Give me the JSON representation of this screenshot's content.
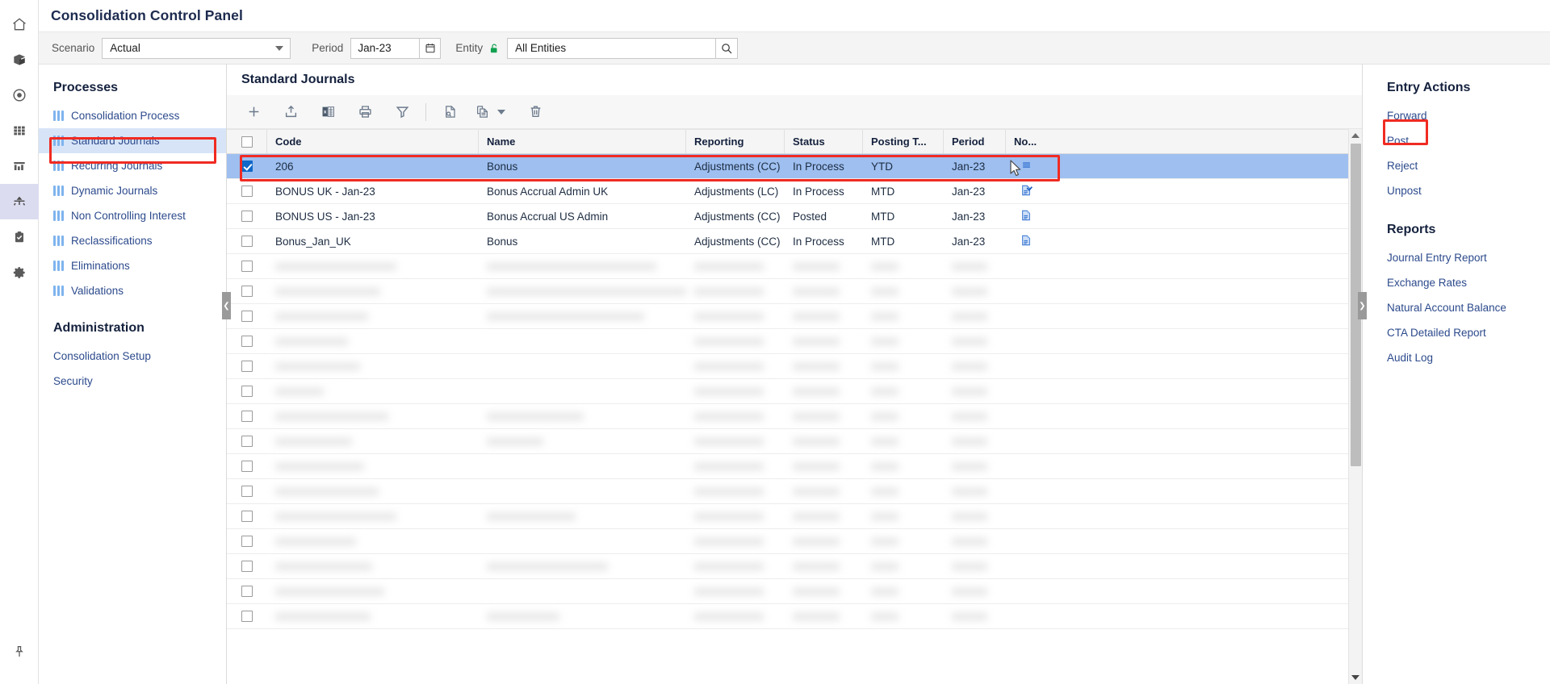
{
  "window": {
    "title": "Consolidation Control Panel"
  },
  "rail": {
    "items": [
      {
        "name": "home-icon",
        "label": "Home"
      },
      {
        "name": "cube-icon",
        "label": "Cube"
      },
      {
        "name": "target-icon",
        "label": "Target"
      },
      {
        "name": "grid-icon",
        "label": "Grid"
      },
      {
        "name": "report-icon",
        "label": "Reports"
      },
      {
        "name": "consolidation-icon",
        "label": "Consolidation"
      },
      {
        "name": "clipboard-check-icon",
        "label": "Tasks"
      },
      {
        "name": "gear-icon",
        "label": "Settings"
      }
    ],
    "pin": {
      "name": "pin-icon",
      "label": "Pin"
    }
  },
  "filterbar": {
    "scenario_label": "Scenario",
    "scenario_value": "Actual",
    "period_label": "Period",
    "period_value": "Jan-23",
    "entity_label": "Entity",
    "entity_value": "All Entities"
  },
  "sidebar": {
    "processes_heading": "Processes",
    "processes": [
      {
        "label": "Consolidation Process",
        "selected": false
      },
      {
        "label": "Standard Journals",
        "selected": true
      },
      {
        "label": "Recurring Journals",
        "selected": false
      },
      {
        "label": "Dynamic Journals",
        "selected": false
      },
      {
        "label": "Non Controlling Interest",
        "selected": false
      },
      {
        "label": "Reclassifications",
        "selected": false
      },
      {
        "label": "Eliminations",
        "selected": false
      },
      {
        "label": "Validations",
        "selected": false
      }
    ],
    "administration_heading": "Administration",
    "administration": [
      {
        "label": "Consolidation Setup"
      },
      {
        "label": "Security"
      }
    ]
  },
  "content": {
    "title": "Standard Journals",
    "toolbar": [
      {
        "name": "add-button",
        "label": "Add"
      },
      {
        "name": "upload-button",
        "label": "Upload"
      },
      {
        "name": "export-excel-button",
        "label": "Export to Excel"
      },
      {
        "name": "print-button",
        "label": "Print"
      },
      {
        "name": "filter-button",
        "label": "Filter"
      },
      {
        "name": "inspect-button",
        "label": "Inspect"
      },
      {
        "name": "copy-button",
        "label": "Copy"
      },
      {
        "name": "delete-button",
        "label": "Delete"
      }
    ]
  },
  "table": {
    "columns": [
      "",
      "Code",
      "Name",
      "Reporting",
      "Status",
      "Posting T...",
      "Period",
      "No..."
    ],
    "rows": [
      {
        "checked": true,
        "selected": true,
        "code": "206",
        "name": "Bonus",
        "reporting": "Adjustments (CC)",
        "status": "In Process",
        "posting_type": "YTD",
        "period": "Jan-23",
        "note_icon": "note-lines-icon"
      },
      {
        "checked": false,
        "selected": false,
        "code": "BONUS UK - Jan-23",
        "name": "Bonus Accrual Admin UK",
        "reporting": "Adjustments (LC)",
        "status": "In Process",
        "posting_type": "MTD",
        "period": "Jan-23",
        "note_icon": "note-check-icon"
      },
      {
        "checked": false,
        "selected": false,
        "code": "BONUS US - Jan-23",
        "name": "Bonus Accrual US Admin",
        "reporting": "Adjustments (CC)",
        "status": "Posted",
        "posting_type": "MTD",
        "period": "Jan-23",
        "note_icon": "note-doc-icon"
      },
      {
        "checked": false,
        "selected": false,
        "code": "Bonus_Jan_UK",
        "name": "Bonus",
        "reporting": "Adjustments (CC)",
        "status": "In Process",
        "posting_type": "MTD",
        "period": "Jan-23",
        "note_icon": "note-doc-icon"
      }
    ],
    "obscured_row_count": 15
  },
  "rightpanel": {
    "entry_actions_heading": "Entry Actions",
    "entry_actions": [
      {
        "label": "Forward",
        "highlighted": false
      },
      {
        "label": "Post",
        "highlighted": true
      },
      {
        "label": "Reject",
        "highlighted": false
      },
      {
        "label": "Unpost",
        "highlighted": false
      }
    ],
    "reports_heading": "Reports",
    "reports": [
      {
        "label": "Journal Entry Report"
      },
      {
        "label": "Exchange Rates"
      },
      {
        "label": "Natural Account Balance"
      },
      {
        "label": "CTA Detailed Report"
      },
      {
        "label": "Audit Log"
      }
    ]
  },
  "colors": {
    "highlight_box": "#f02b22",
    "row_selected": "#9ebff0",
    "sidebar_selected": "#d7e4f8",
    "link": "#2c4a8c",
    "heading": "#14213d",
    "lock_green": "#12a150"
  }
}
